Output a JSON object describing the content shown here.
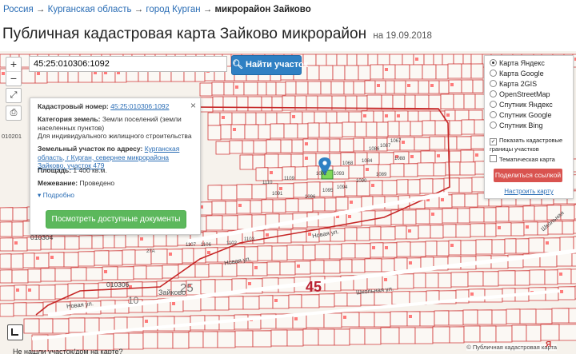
{
  "breadcrumb": {
    "items": [
      "Россия",
      "Курганская область",
      "город Курган"
    ],
    "current": "микрорайон Зайково",
    "separator": "→"
  },
  "page": {
    "title": "Публичная кадастровая карта Зайково микрорайон",
    "date": "на 19.09.2018"
  },
  "map": {
    "zoom_in": "+",
    "zoom_out": "−",
    "search_value": "45:25:010306:1092",
    "search_button": "Найти участок",
    "labels": {
      "quarter_big": "45",
      "quarter_25": "25",
      "q010201": "010201",
      "q010304": "010304",
      "q010306": "010306",
      "q10": "10",
      "street_novaya_1": "Новая ул.",
      "street_novaya_2": "Новая ул.",
      "street_novaya_3": "Новая ул.",
      "street_shkolnaya_1": "Школьная ул.",
      "street_shkolnaya_2": "Школьная",
      "street_zaykovo": "Зайково",
      "plot_1092": "1092",
      "plot_1091": "1091",
      "plot_1093": "1093",
      "plot_1094": "1094",
      "plot_1095": "1095",
      "plot_1096": "1096",
      "plot_1090": "1090",
      "plot_1089": "1089",
      "plot_1088": "1088",
      "plot_1087": "1087",
      "plot_1086": "1086",
      "plot_1084": "1084",
      "plot_1068": "1068",
      "plot_1067": "1067",
      "plot_1109": "1109",
      "plot_1110": "1110",
      "plot_1103": "1103",
      "plot_1102": "1102",
      "plot_1107": "1107",
      "plot_1106": "1106",
      "plot_27a": "27А"
    },
    "legend_hint": "Не нашли участок/дом на карте?",
    "copyright": "© Публичная кадастровая карта",
    "yandex_mark": "Я"
  },
  "popup": {
    "close": "×",
    "cad_label": "Кадастровый номер:",
    "cad_value": "45:25:010306:1092",
    "category_label": "Категория земель:",
    "category_value": "Земли поселений (земли населенных пунктов)",
    "use_value": "Для индивидуального жилищного строительства",
    "address_label": "Земельный участок по адресу:",
    "address_value": "Курганская область, г Курган, севернее микрорайона Зайково, участок 479",
    "area_label": "Площадь:",
    "area_value": "1 400 кв.м.",
    "survey_label": "Межевание:",
    "survey_value": "Проведено",
    "more": "Подробно",
    "docs_button": "Посмотреть доступные документы"
  },
  "layers": {
    "options": [
      "Карта Яндекс",
      "Карта Google",
      "Карта 2GIS",
      "OpenStreetMap",
      "Спутник Яндекс",
      "Спутник Google",
      "Спутник Bing"
    ],
    "selected": 0,
    "show_borders": "Показать кадастровые границы участков",
    "thematic": "Тематическая карта",
    "share_button": "Поделиться ссылкой",
    "configure_link": "Настроить карту"
  },
  "colors": {
    "accent": "#2f80c3",
    "parcel_border": "#d03a3a",
    "selected_parcel": "#7ed957",
    "share": "#d9534f",
    "docs": "#5cb85c"
  }
}
